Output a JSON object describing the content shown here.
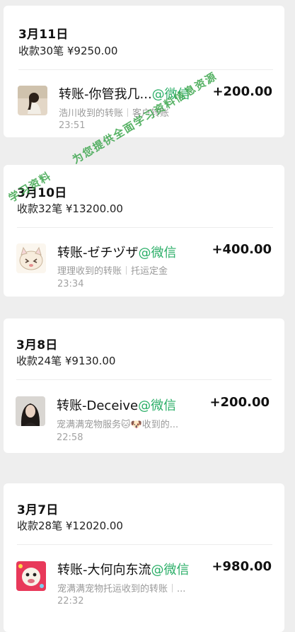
{
  "transactions": [
    {
      "date": "3月11日",
      "summary": "收款30笔 ¥9250.00",
      "item": {
        "title": "转账-你管我几...",
        "source": "@微信",
        "amount": "+200.00",
        "receiver": "浩川收到的转账",
        "note": "客户转账",
        "time": "23:51"
      }
    },
    {
      "date": "3月10日",
      "summary": "收款32笔 ¥13200.00",
      "item": {
        "title": "转账-ゼチヅザ",
        "source": "@微信",
        "amount": "+400.00",
        "receiver": "理理收到的转账",
        "note": "托运定金",
        "time": "23:34"
      }
    },
    {
      "date": "3月8日",
      "summary": "收款24笔 ¥9130.00",
      "item": {
        "title": "转账-Deceive",
        "source": "@微信",
        "amount": "+200.00",
        "receiver": "宠满满宠物服务🐱🐶收到的...",
        "note": "",
        "time": "22:58"
      }
    },
    {
      "date": "3月7日",
      "summary": "收款28笔 ¥12020.00",
      "item": {
        "title": "转账-大何向东流",
        "source": "@微信",
        "amount": "+980.00",
        "receiver": "宠满满宠物托运收到的转账",
        "note": "...",
        "time": "22:32"
      }
    }
  ],
  "watermark": "学习资料",
  "watermark_tail": "为您提供全面学习资料信息资源",
  "colors": {
    "source": "#2aae67",
    "watermark": "#3aa54b"
  }
}
